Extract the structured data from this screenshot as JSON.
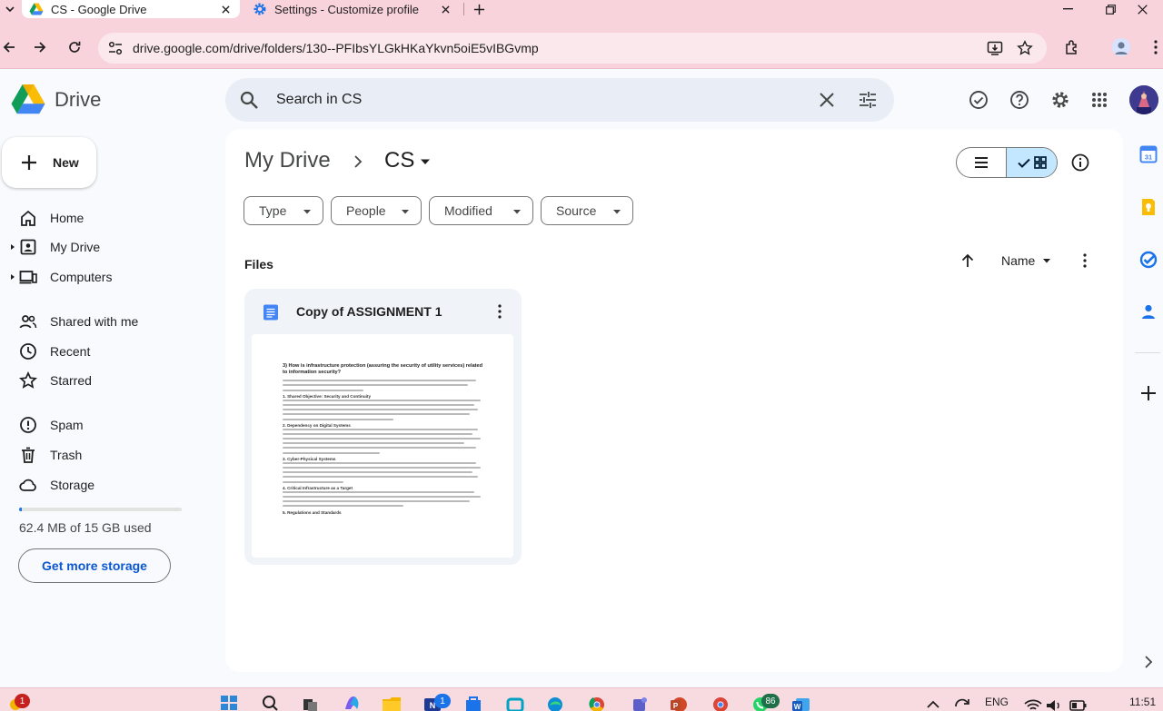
{
  "browser": {
    "tabs": [
      {
        "title": "CS - Google Drive",
        "icon": "google-drive-icon",
        "active": true
      },
      {
        "title": "Settings - Customize profile",
        "icon": "gear-icon",
        "active": false
      }
    ],
    "url": "drive.google.com/drive/folders/130--PFIbsYLGkHKaYkvn5oiE5vIBGvmp"
  },
  "drive": {
    "brand": "Drive",
    "search": {
      "placeholder": "Search in CS",
      "value": ""
    },
    "new_button": "New",
    "nav": [
      {
        "label": "Home",
        "icon": "home-icon"
      },
      {
        "label": "My Drive",
        "icon": "my-drive-icon"
      },
      {
        "label": "Computers",
        "icon": "computer-icon"
      },
      {
        "label": "Shared with me",
        "icon": "shared-icon"
      },
      {
        "label": "Recent",
        "icon": "clock-icon"
      },
      {
        "label": "Starred",
        "icon": "star-icon"
      },
      {
        "label": "Spam",
        "icon": "spam-icon"
      },
      {
        "label": "Trash",
        "icon": "trash-icon"
      },
      {
        "label": "Storage",
        "icon": "cloud-icon"
      }
    ],
    "storage": {
      "used_text": "62.4 MB of 15 GB used",
      "used_fraction": 0.004,
      "cta": "Get more storage"
    },
    "breadcrumb": {
      "root": "My Drive",
      "current": "CS"
    },
    "filters": [
      "Type",
      "People",
      "Modified",
      "Source"
    ],
    "section_label": "Files",
    "sort": {
      "label": "Name",
      "direction": "ascending"
    },
    "files": [
      {
        "name": "Copy of ASSIGNMENT 1",
        "type": "google-doc",
        "preview": {
          "question": "3)   How is infrastructure protection (assuring the security of utility     services) related to information security?",
          "headings": [
            "1. Shared Objective: Security and Continuity",
            "2. Dependency on Digital Systems",
            "3. Cyber-Physical Systems",
            "4. Critical Infrastructure as a Target",
            "5. Regulations and Standards"
          ]
        }
      }
    ]
  },
  "taskbar": {
    "notification_badge": "1",
    "app_badge_1": "1",
    "app_badge_2": "86",
    "language": "ENG",
    "time": "11:51"
  },
  "colors": {
    "accent": "#0b57d0",
    "chrome": "#f9d3dc",
    "selected": "#c2e7ff"
  }
}
